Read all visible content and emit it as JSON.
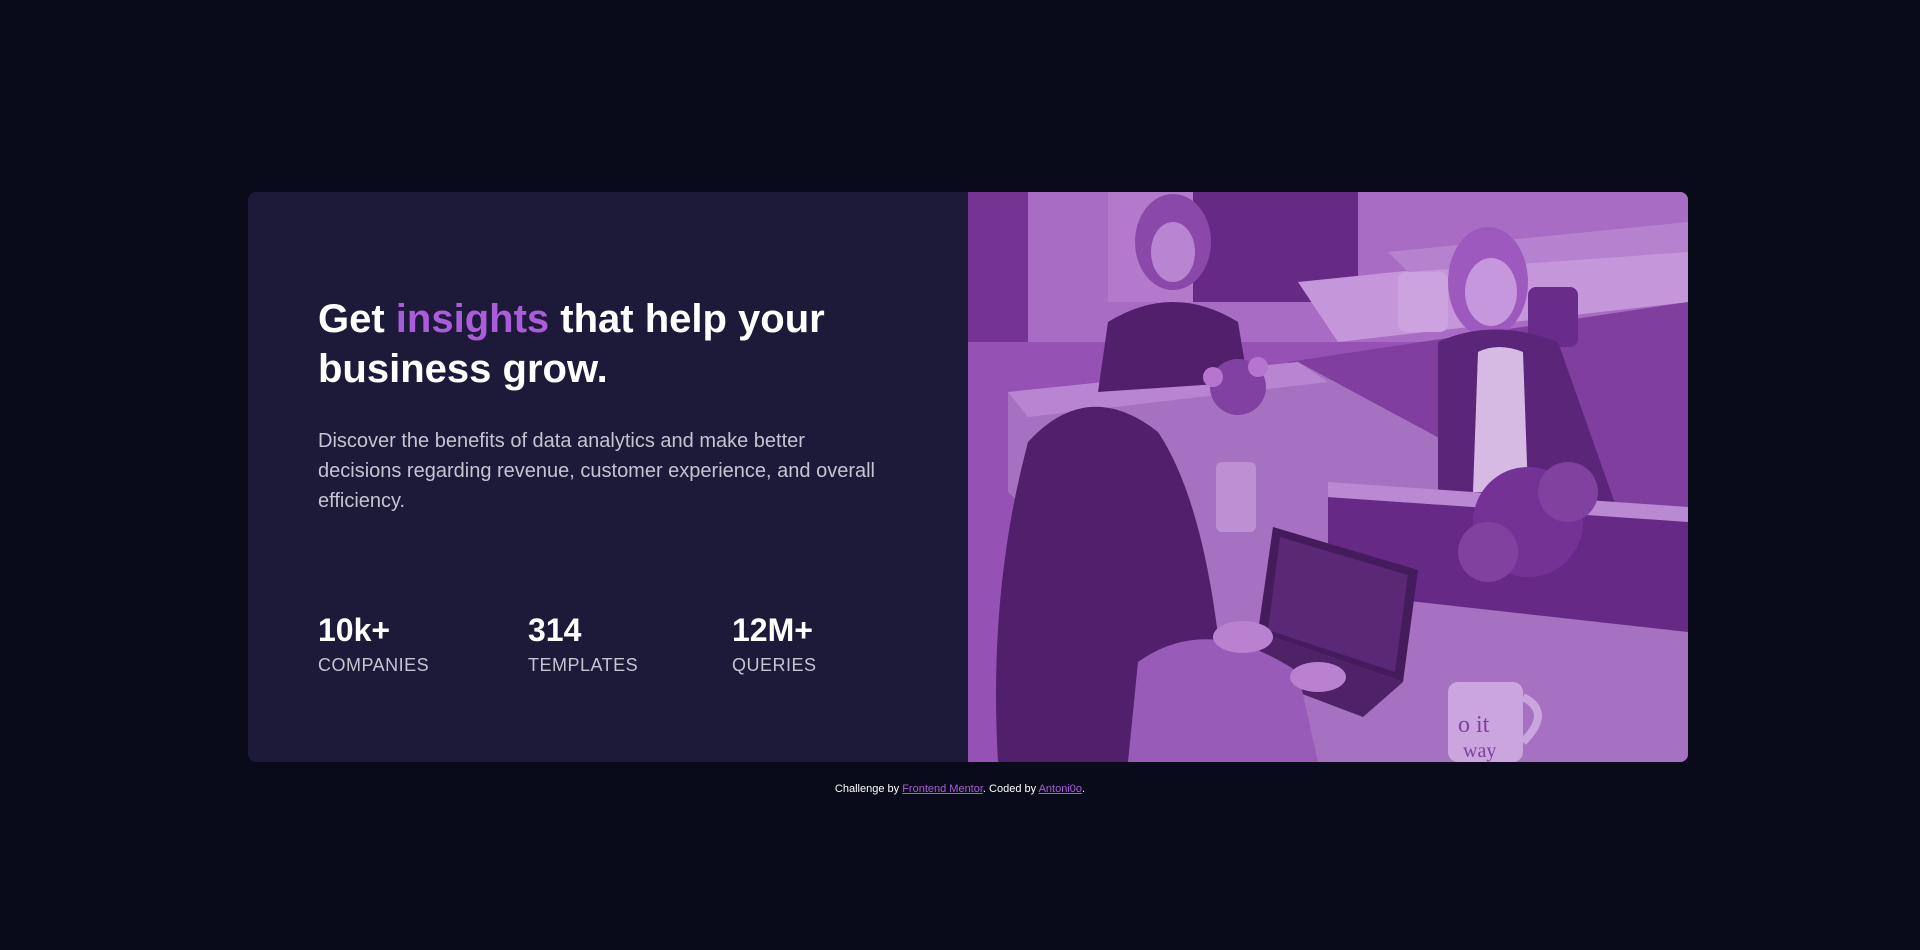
{
  "card": {
    "headline": {
      "prefix": "Get ",
      "accent": "insights",
      "suffix": " that help your business grow."
    },
    "description": "Discover the benefits of data analytics and make better decisions regarding revenue, customer experience, and overall efficiency.",
    "stats": [
      {
        "value": "10k+",
        "label": "COMPANIES"
      },
      {
        "value": "314",
        "label": "TEMPLATES"
      },
      {
        "value": "12M+",
        "label": "QUERIES"
      }
    ],
    "image": {
      "mug_text": "o it",
      "mug_text_2": "way"
    }
  },
  "attribution": {
    "prefix": "Challenge by ",
    "link1": "Frontend Mentor",
    "middle": ". Coded by ",
    "link2": "Antoni0o",
    "suffix": "."
  },
  "colors": {
    "background": "#090b1a",
    "card": "#1c1a38",
    "accent": "#ab5cdb",
    "text_muted": "#c5c4d2",
    "image_overlay": "#8d47ab"
  }
}
